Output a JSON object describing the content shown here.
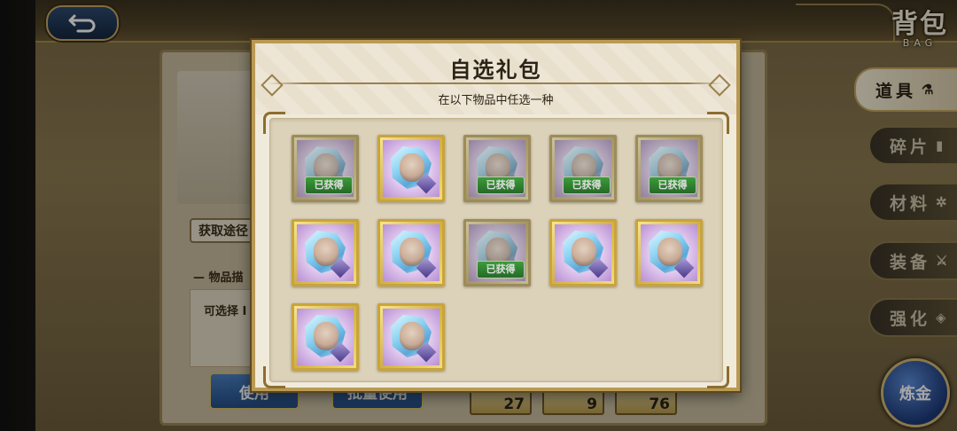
{
  "header": {
    "title_cn": "背包",
    "title_en": "BAG"
  },
  "background": {
    "source_button": "获取途径",
    "desc_heading": "— 物品描",
    "desc_text": "可选择 I",
    "use_button": "使用",
    "bulk_use_button": "批量使用",
    "counts": [
      "27",
      "9",
      "76"
    ]
  },
  "sidebar": {
    "tabs": [
      {
        "label": "道具",
        "icon": "potion-icon",
        "active": true
      },
      {
        "label": "碎片",
        "icon": "shard-icon",
        "active": false
      },
      {
        "label": "材料",
        "icon": "gear-icon",
        "active": false
      },
      {
        "label": "装备",
        "icon": "equipment-icon",
        "active": false
      },
      {
        "label": "强化",
        "icon": "enhance-icon",
        "active": false
      }
    ],
    "alchemy_label": "炼金"
  },
  "modal": {
    "title": "自选礼包",
    "subtitle": "在以下物品中任选一种",
    "owned_label": "已获得",
    "items": [
      {
        "owned": true
      },
      {
        "owned": false
      },
      {
        "owned": true
      },
      {
        "owned": true
      },
      {
        "owned": true
      },
      {
        "owned": false
      },
      {
        "owned": false
      },
      {
        "owned": true
      },
      {
        "owned": false
      },
      {
        "owned": false
      },
      {
        "owned": false
      },
      {
        "owned": false
      }
    ]
  }
}
